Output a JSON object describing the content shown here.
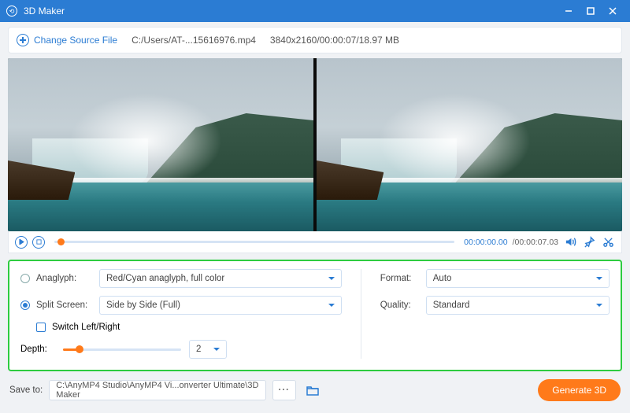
{
  "titlebar": {
    "app_name": "3D Maker"
  },
  "toolbar": {
    "change_label": "Change Source File",
    "filepath": "C:/Users/AT-...15616976.mp4",
    "fileinfo": "3840x2160/00:00:07/18.97 MB"
  },
  "playbar": {
    "time_current": "00:00:00.00",
    "time_total": "/00:00:07.03"
  },
  "settings": {
    "anaglyph_label": "Anaglyph:",
    "anaglyph_value": "Red/Cyan anaglyph, full color",
    "split_label": "Split Screen:",
    "split_value": "Side by Side (Full)",
    "switch_label": "Switch Left/Right",
    "depth_label": "Depth:",
    "depth_value": "2",
    "format_label": "Format:",
    "format_value": "Auto",
    "quality_label": "Quality:",
    "quality_value": "Standard"
  },
  "footer": {
    "save_label": "Save to:",
    "save_path": "C:\\AnyMP4 Studio\\AnyMP4 Vi...onverter Ultimate\\3D Maker",
    "dots": "···",
    "generate_label": "Generate 3D"
  }
}
